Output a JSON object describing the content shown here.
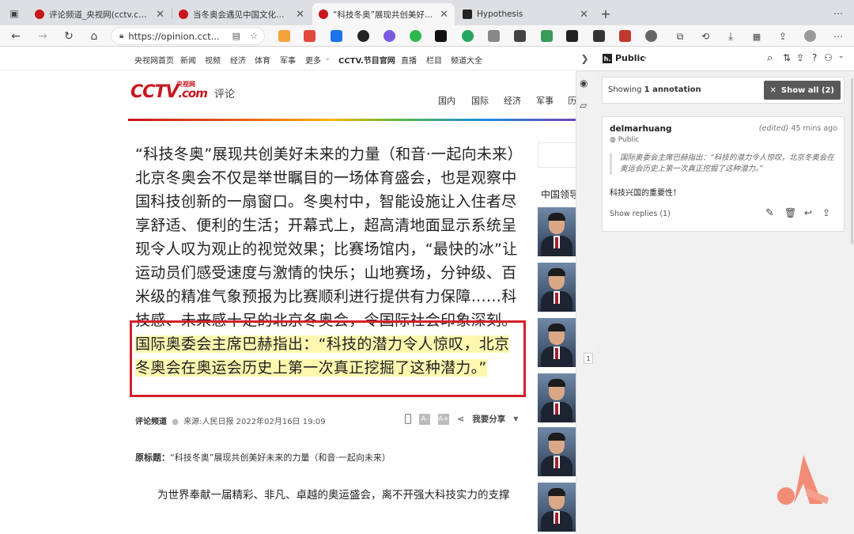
{
  "tabs": [
    {
      "title": "评论频道_央视网(cctv.com)",
      "favicon_color": "#c8161d"
    },
    {
      "title": "当冬奥会遇见中国文化（人民时...",
      "favicon_color": "#c8161d"
    },
    {
      "title": "“科技冬奥”展现共创美好未来的...",
      "favicon_color": "#c8161d"
    },
    {
      "title": "Hypothesis",
      "favicon_color": "#222222"
    }
  ],
  "browser": {
    "url": "https://opinion.cct..."
  },
  "site_nav": [
    "央视网首页",
    "新闻",
    "视频",
    "经济",
    "体育",
    "军事",
    "更多",
    "CCTV.节目官网",
    "直播",
    "栏目",
    "频道大全"
  ],
  "header": {
    "logo": "CCTV",
    "logo_sub": ".com",
    "logo_cn": "央视网",
    "section": "评论",
    "cats": [
      "国内",
      "国际",
      "经济",
      "军事",
      "历"
    ]
  },
  "article": {
    "text_main": "“科技冬奥”展现共创美好未来的力量（和音·一起向未来）北京冬奥会不仅是举世瞩目的一场体育盛会，也是观察中国科技创新的一扇窗口。冬奥村中，智能设施让入住者尽享舒适、便利的生活；开幕式上，超高清地面显示系统呈现令人叹为观止的视觉效果；比赛场馆内，“最快的冰”让运动员们感受速度与激情的快乐；山地赛场，分钟级、百米级的精准气象预报为比赛顺利进行提供有力保障……科技感、未来感十足的北京冬奥会，令国际社会印象深刻。",
    "text_highlight": "国际奥委会主席巴赫指出：“科技的潜力令人惊叹，北京冬奥会在奥运会历史上第一次真正挖掘了这种潜力。”",
    "channel": "评论频道",
    "source": "来源:人民日报 2022年02月16日 19:09",
    "share": "我要分享",
    "font_small": "A-",
    "font_large": "A+",
    "orig_label": "原标题：",
    "orig_title": "“科技冬奥”展现共创美好未来的力量（和音·一起向未来）",
    "para1": "为世界奉献一届精彩、非凡、卓越的奥运盛会，离不开强大科技实力的支撑"
  },
  "sidebar": {
    "title": "中国领导"
  },
  "hypothesis": {
    "group": "Public",
    "showing": "Showing ",
    "showing_count": "1 annotation",
    "show_all": "Show all (2)",
    "user": "delmarhuang",
    "edited": "(edited)",
    "time": "45 mins ago",
    "visibility": "Public",
    "quote": "国际奥委会主席巴赫指出：“科技的潜力令人惊叹，北京冬奥会在奥运会历史上第一次真正挖掘了这种潜力。”",
    "comment": "科技兴国的重要性！",
    "replies": "Show replies (1)",
    "highlight_count": "1"
  }
}
